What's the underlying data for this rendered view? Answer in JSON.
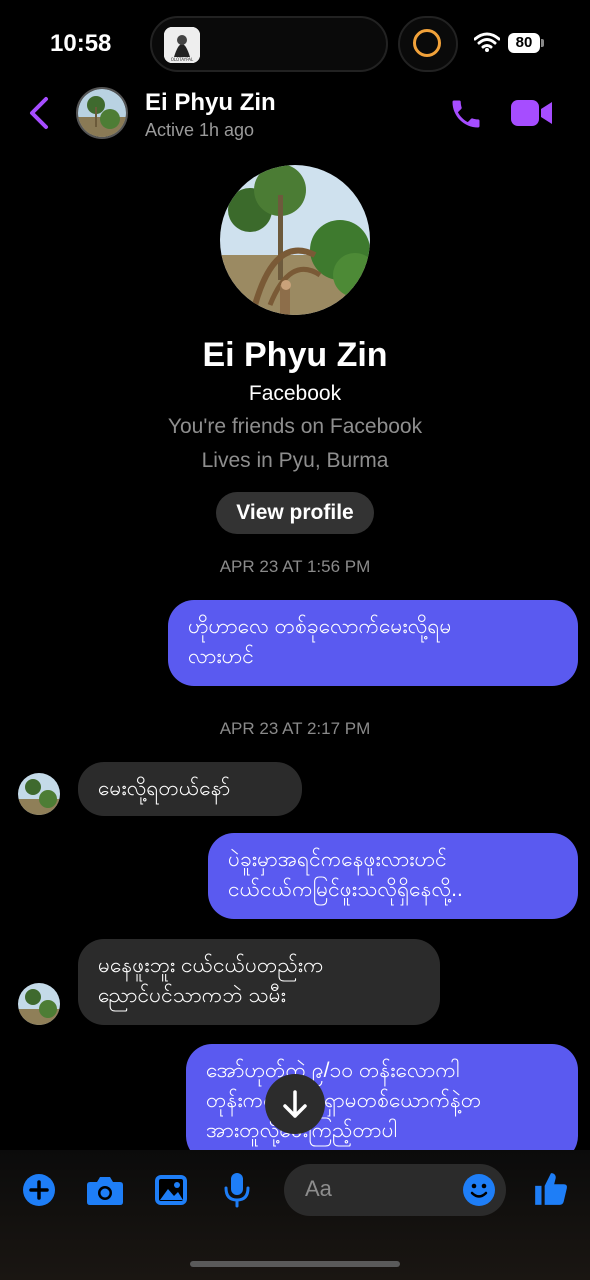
{
  "status_bar": {
    "time": "10:58",
    "battery": "80",
    "island_thumb_text": "OLOTAYPAL"
  },
  "header": {
    "name": "Ei Phyu Zin",
    "status": "Active 1h ago"
  },
  "profile": {
    "name": "Ei Phyu Zin",
    "source": "Facebook",
    "friends": "You're friends on Facebook",
    "lives": "Lives in Pyu, Burma",
    "view_profile_label": "View profile"
  },
  "messages": [
    {
      "type": "timestamp",
      "text": "APR 23 AT 1:56 PM"
    },
    {
      "type": "outgoing",
      "lines": [
        "ဟိုဟာလေ တစ်ခုလောက်မေးလို့ရမ",
        "လားဟင်"
      ]
    },
    {
      "type": "timestamp",
      "text": "APR 23 AT 2:17 PM"
    },
    {
      "type": "incoming",
      "lines": [
        "မေးလို့ရတယ်နော်"
      ]
    },
    {
      "type": "outgoing",
      "lines": [
        "ပဲခူးမှာအရင်ကနေဖူးလားဟင်",
        "ငယ်ငယ်ကမြင်ဖူးသလိုရှိနေလို့.."
      ]
    },
    {
      "type": "incoming",
      "lines": [
        "မနေဖူးဘူး ငယ်ငယ်ပတည်းက",
        "ညောင်ပင်သာကဘဲ သမီး"
      ]
    },
    {
      "type": "outgoing",
      "lines": [
        "အော်ဟုတ်ကဲ့ ၉/၁၀ တန်းလောကါ",
        "တုန်းကကျောင်းရှာမတစ်ယောက်နဲ့တ",
        "အားတူလို့မေးကြည့်တာပါ"
      ]
    }
  ],
  "composer": {
    "placeholder": "Aa"
  },
  "colors": {
    "accent": "#a64dff",
    "bubble_out": "#5a5af0",
    "bubble_in": "#2b2b2b",
    "icon_blue": "#1e7ef7"
  },
  "icons": [
    "back-chevron",
    "phone",
    "video-camera",
    "plus",
    "camera",
    "image",
    "microphone",
    "emoji",
    "thumbs-up",
    "arrow-down"
  ]
}
